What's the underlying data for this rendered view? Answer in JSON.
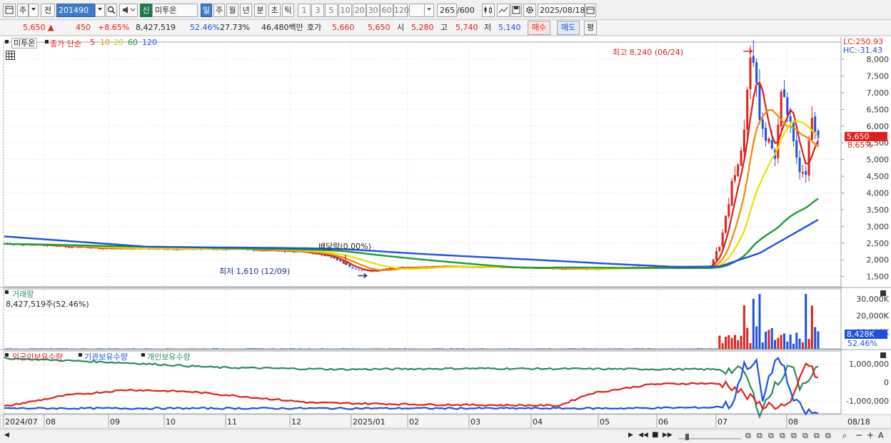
{
  "toolbar": {
    "market_label": "주",
    "mode_label": "전",
    "code": "201490",
    "badge": "신",
    "stock_name": "미투온",
    "periods": [
      "일",
      "주",
      "월",
      "년",
      "분",
      "초",
      "틱"
    ],
    "active_period": "일",
    "intervals": [
      "1",
      "3",
      "5",
      "10",
      "20",
      "30",
      "60",
      "120"
    ],
    "count": "265",
    "count_max": "/600",
    "date": "2025/08/18"
  },
  "quote": {
    "price": "5,650",
    "arrow": "▲",
    "change": "450",
    "change_pct": "+8.65%",
    "volume": "8,427,519",
    "turnover": "52.46%",
    "rate2": "27.73%",
    "amount": "46,480백만",
    "hoga_label": "호가",
    "ask": "5,660",
    "bid": "5,650",
    "open_label": "시",
    "open": "5,280",
    "high_label": "고",
    "high": "5,740",
    "low_label": "저",
    "low": "5,140",
    "buy_label": "매수",
    "sell_label": "매도",
    "avg_label": "평"
  },
  "price_panel": {
    "title": "미투온",
    "legend_prefix": "종가 단순",
    "ma_labels": [
      "5",
      "10",
      "20",
      "60",
      "120"
    ],
    "ma_colors": [
      "#d8201a",
      "#f08a00",
      "#e8e000",
      "#1e9a30",
      "#1e50e0"
    ],
    "lc": "LC:250.93",
    "hc": "HC:-31.43",
    "high_marker": "최고 8,240 (06/24)",
    "low_marker": "최저 1,610 (12/09)",
    "dividend_marker": "배당락(0.00%)",
    "current_price": "5,650",
    "current_pct": "8.65%",
    "y_ticks": [
      "8,000",
      "7,500",
      "7,000",
      "6,500",
      "6,000",
      "5,500",
      "5,000",
      "4,500",
      "4,000",
      "3,500",
      "3,000",
      "2,500",
      "2,000",
      "1,500"
    ]
  },
  "volume_panel": {
    "title": "거래량",
    "summary": "8,427,519주(52.46%)",
    "current": "8,428K",
    "current_pct": "52.46%",
    "y_ticks": [
      "30,000K",
      "20,000K",
      "10,000K"
    ]
  },
  "holding_panel": {
    "legend": [
      "외국인보유수량",
      "기관보유수량",
      "개인보유수량"
    ],
    "legend_colors": [
      "#d8201a",
      "#1e50e0",
      "#2a8a60"
    ],
    "y_ticks": [
      "1,000,000",
      "0",
      "-1,000,000"
    ]
  },
  "x_axis": {
    "labels": [
      "2024/07",
      "08",
      "09",
      "10",
      "11",
      "12",
      "2025/01",
      "02",
      "03",
      "04",
      "05",
      "06",
      "07",
      "08"
    ],
    "last_label": "08/18"
  },
  "chart_data": {
    "type": "line",
    "ylim": [
      1300,
      8300
    ],
    "series": [
      {
        "name": "5",
        "values": []
      },
      {
        "name": "10",
        "values": []
      },
      {
        "name": "20",
        "values": []
      },
      {
        "name": "60",
        "values": []
      },
      {
        "name": "120",
        "values": []
      }
    ],
    "high": 8240,
    "low": 1610,
    "last_close": 5650
  }
}
